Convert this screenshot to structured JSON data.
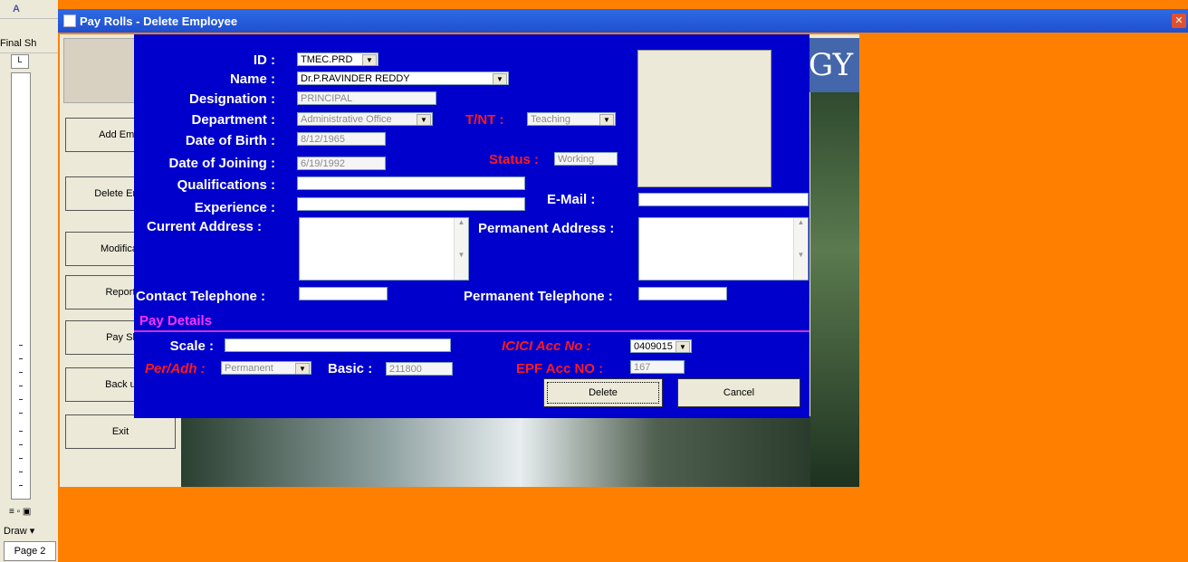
{
  "window": {
    "title": "Pay Rolls - Delete Employee"
  },
  "word": {
    "toolbar_label": "Final Sh",
    "draw_label": "Draw ▾",
    "page_label": "Page 2"
  },
  "banner_text": "GY",
  "side_buttons": [
    "Add Empl",
    "Delete Emp",
    "Modificat",
    "Report",
    "Pay Sl",
    "Back u",
    "Exit"
  ],
  "form": {
    "id": {
      "label": "ID :",
      "value": "TMEC.PRD"
    },
    "name": {
      "label": "Name :",
      "value": "Dr.P.RAVINDER REDDY"
    },
    "designation": {
      "label": "Designation :",
      "value": "PRINCIPAL"
    },
    "department": {
      "label": "Department :",
      "value": "Administrative Office"
    },
    "tnt": {
      "label": "T/NT :",
      "value": "Teaching"
    },
    "dob": {
      "label": "Date of Birth :",
      "value": "8/12/1965"
    },
    "doj": {
      "label": "Date of Joining :",
      "value": "6/19/1992"
    },
    "status": {
      "label": "Status :",
      "value": "Working"
    },
    "qualifications": {
      "label": "Qualifications :",
      "value": ""
    },
    "experience": {
      "label": "Experience :",
      "value": ""
    },
    "email": {
      "label": "E-Mail :",
      "value": ""
    },
    "current_address": {
      "label": "Current Address :"
    },
    "permanent_address": {
      "label": "Permanent Address :"
    },
    "contact_phone": {
      "label": "Contact Telephone :",
      "value": ""
    },
    "permanent_phone": {
      "label": "Permanent Telephone :",
      "value": ""
    }
  },
  "pay": {
    "section_label": "Pay Details",
    "scale": {
      "label": "Scale :",
      "value": ""
    },
    "icici": {
      "label": "ICICI  Acc No :",
      "value": "0409015"
    },
    "peradh": {
      "label": "Per/Adh :",
      "value": "Permanent"
    },
    "basic": {
      "label": "Basic :",
      "value": "211800"
    },
    "epf": {
      "label": "EPF Acc NO :",
      "value": "167"
    }
  },
  "buttons": {
    "delete": "Delete",
    "cancel": "Cancel"
  },
  "colors": {
    "dialog_bg": "#0000cc",
    "desktop_bg": "#ff8000",
    "label_white": "#ffffff",
    "label_red": "#ff1a1a",
    "section_magenta": "#ff33ff"
  }
}
